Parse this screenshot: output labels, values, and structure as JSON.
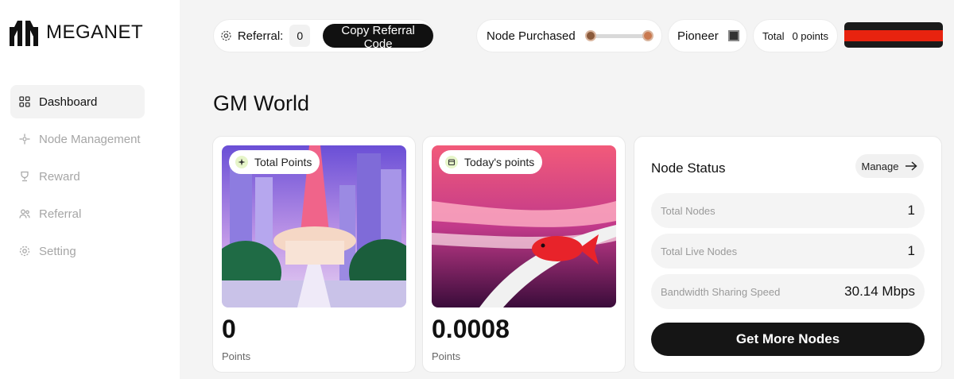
{
  "brand": {
    "name": "MEGANET"
  },
  "sidebar": {
    "items": [
      {
        "label": "Dashboard",
        "icon": "grid-icon",
        "active": true
      },
      {
        "label": "Node Management",
        "icon": "node-icon",
        "active": false
      },
      {
        "label": "Reward",
        "icon": "trophy-icon",
        "active": false
      },
      {
        "label": "Referral",
        "icon": "users-icon",
        "active": false
      },
      {
        "label": "Setting",
        "icon": "gear-icon",
        "active": false
      }
    ]
  },
  "topbar": {
    "referral_label": "Referral:",
    "referral_count": "0",
    "copy_button": "Copy Referral Code",
    "node_purchased_label": "Node Purchased",
    "tier_label": "Pioneer",
    "total_label": "Total",
    "total_value": "0 points"
  },
  "main": {
    "greeting": "GM World",
    "cards": [
      {
        "badge": "Total Points",
        "badge_icon": "sparkle-icon",
        "value": "0",
        "label": "Points"
      },
      {
        "badge": "Today's points",
        "badge_icon": "calendar-icon",
        "value": "0.0008",
        "label": "Points"
      }
    ],
    "node_status": {
      "title": "Node Status",
      "manage": "Manage",
      "rows": [
        {
          "label": "Total Nodes",
          "value": "1"
        },
        {
          "label": "Total Live Nodes",
          "value": "1"
        },
        {
          "label": "Bandwidth Sharing Speed",
          "value": "30.14 Mbps"
        }
      ],
      "cta": "Get More Nodes"
    }
  },
  "colors": {
    "accent_dark": "#111111",
    "account_stripe": "#e8230f",
    "muted_text": "#a6a6a6"
  }
}
